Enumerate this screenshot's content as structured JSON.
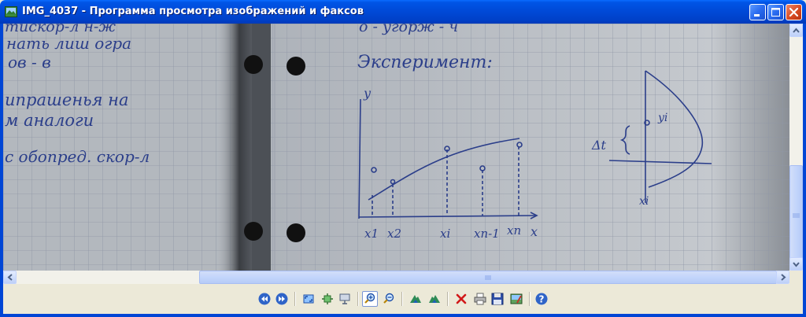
{
  "window": {
    "title": "IMG_4037 - Программа просмотра изображений и факсов",
    "app_icon": "image-viewer-icon"
  },
  "title_buttons": [
    {
      "name": "minimize-icon"
    },
    {
      "name": "maximize-icon"
    },
    {
      "name": "close-icon"
    }
  ],
  "image": {
    "notebook_text": {
      "left_line1": "тискор-л   н-ж",
      "left_line2": "нать лиш огра",
      "left_line3": "ов - в",
      "left_line4": "ипрашенья на",
      "left_line5": "м  аналоги",
      "left_line6": "с обопред. скор-л",
      "right_top": "о - угорж - ч",
      "heading": "Эксперимент:",
      "axis_y": "y",
      "axis_x": "x",
      "x1": "x1",
      "x2": "x2",
      "xi": "xi",
      "xn1": "xn-1",
      "xn": "xn",
      "delta_t": "Δt",
      "yi": "yi",
      "xi_right": "xi"
    }
  },
  "toolbar": {
    "buttons": [
      {
        "name": "previous-image-icon",
        "tooltip": ""
      },
      {
        "name": "next-image-icon"
      },
      {
        "name": "best-fit-icon"
      },
      {
        "name": "actual-size-icon"
      },
      {
        "name": "slideshow-icon"
      },
      {
        "name": "zoom-in-icon",
        "active": true
      },
      {
        "name": "zoom-out-icon"
      },
      {
        "name": "rotate-clockwise-icon"
      },
      {
        "name": "rotate-counterclockwise-icon"
      },
      {
        "name": "delete-icon"
      },
      {
        "name": "print-icon"
      },
      {
        "name": "save-icon"
      },
      {
        "name": "open-for-editing-icon"
      },
      {
        "name": "help-icon"
      }
    ]
  },
  "colors": {
    "title_bar": "#0049d6",
    "frame": "#0046d5",
    "close_button": "#d84a22",
    "ink": "#2b3e8a",
    "paper": "#b7bcc2"
  }
}
